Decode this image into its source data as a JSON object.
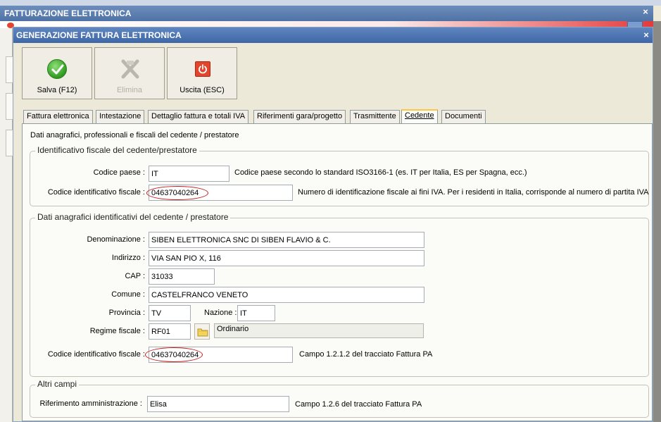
{
  "outer_window": {
    "title": "FATTURAZIONE ELETTRONICA",
    "close_label": "×"
  },
  "window": {
    "title": "GENERAZIONE FATTURA ELETTRONICA",
    "close_label": "×"
  },
  "toolbar": {
    "save_label": "Salva (F12)",
    "delete_label": "Elimina",
    "exit_label": "Uscita (ESC)"
  },
  "tabs": [
    {
      "label": "Fattura elettronica"
    },
    {
      "label": "Intestazione"
    },
    {
      "label": "Dettaglio fattura e totali IVA"
    },
    {
      "label": "Riferimenti gara/progetto"
    },
    {
      "label": "Trasmittente"
    },
    {
      "label": "Cedente"
    },
    {
      "label": "Documenti"
    }
  ],
  "active_tab": "Cedente",
  "panel": {
    "caption": "Dati anagrafici, professionali e fiscali del cedente / prestatore",
    "fiscal_group": {
      "title": "Identificativo fiscale del cedente/prestatore",
      "country_label": "Codice paese :",
      "country_value": "IT",
      "country_hint": "Codice paese secondo lo standard ISO3166-1 (es. IT per Italia, ES per Spagna, ecc.)",
      "taxid_label": "Codice identificativo fiscale :",
      "taxid_value": "04637040264",
      "taxid_hint": "Numero di identificazione fiscale ai fini IVA. Per i residenti in Italia, corrisponde al numero di partita IVA"
    },
    "registry_group": {
      "title": "Dati anagrafici identificativi del cedente / prestatore",
      "name_label": "Denominazione :",
      "name_value": "SIBEN ELETTRONICA SNC DI SIBEN FLAVIO & C.",
      "address_label": "Indirizzo :",
      "address_value": "VIA SAN PIO X, 116",
      "zip_label": "CAP :",
      "zip_value": "31033",
      "city_label": "Comune :",
      "city_value": "CASTELFRANCO VENETO",
      "province_label": "Provincia :",
      "province_value": "TV",
      "nation_label": "Nazione :",
      "nation_value": "IT",
      "regime_label": "Regime fiscale :",
      "regime_code": "RF01",
      "regime_desc": "Ordinario",
      "fiscal_code_label": "Codice identificativo fiscale :",
      "fiscal_code_value": "04637040264",
      "fiscal_code_hint": "Campo 1.2.1.2 del tracciato Fattura PA"
    },
    "other_group": {
      "title": "Altri campi",
      "admin_ref_label": "Riferimento amministrazione :",
      "admin_ref_value": "Elisa",
      "admin_ref_hint": "Campo 1.2.6 del tracciato Fattura PA"
    }
  },
  "colors": {
    "title_bar": "#4f72a6",
    "annotation_circle": "#c21a1a",
    "exit_icon": "#e2452b",
    "ok_icon": "#2f9a1f"
  }
}
